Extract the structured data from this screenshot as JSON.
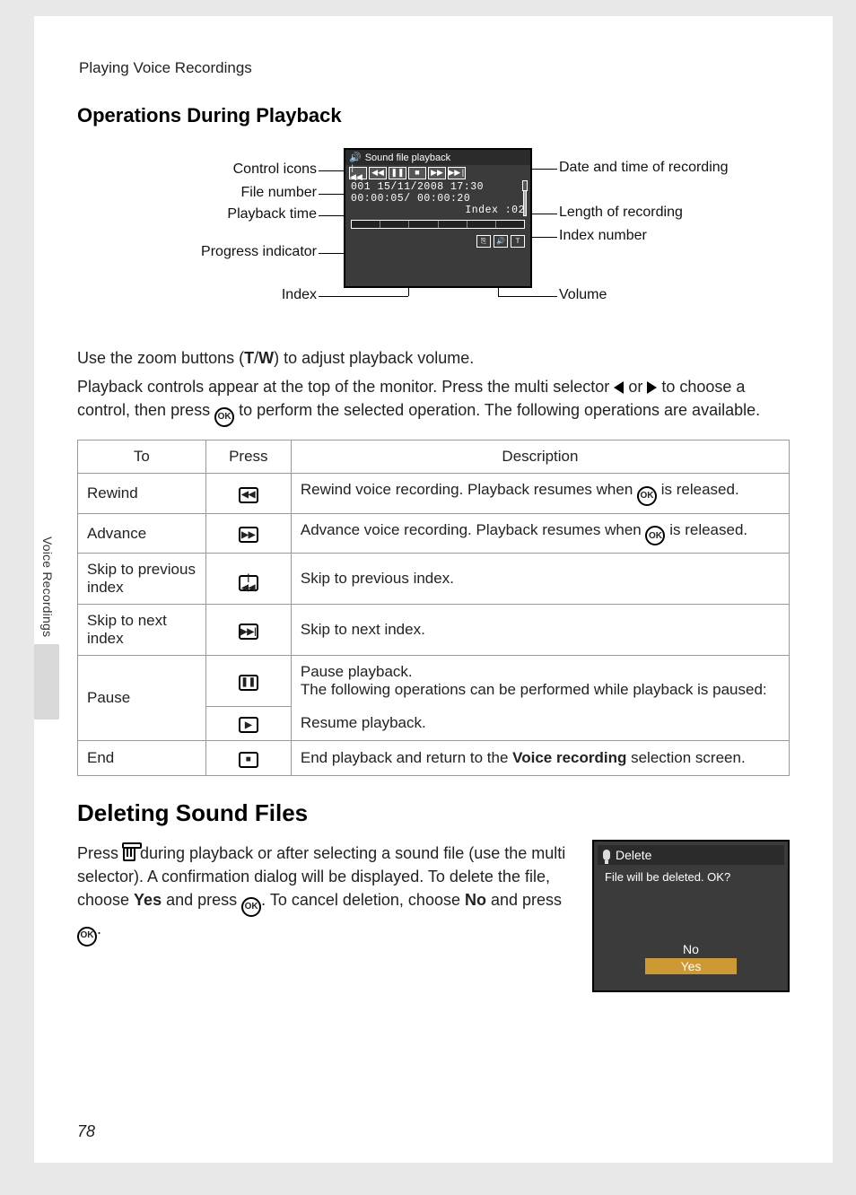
{
  "breadcrumb": "Playing Voice Recordings",
  "sidetab": "Voice Recordings",
  "page_number": "78",
  "heading_operations": "Operations During Playback",
  "callouts": {
    "control_icons": "Control icons",
    "file_number": "File number",
    "playback_time": "Playback time",
    "progress_indicator": "Progress indicator",
    "index": "Index",
    "date_time": "Date and time of recording",
    "length": "Length of recording",
    "index_number": "Index number",
    "volume": "Volume"
  },
  "screen": {
    "title": "Sound file playback",
    "file_line": "001  15/11/2008 17:30",
    "time_line": "00:00:05/ 00:00:20",
    "index_line": "Index :02"
  },
  "para1_a": "Use the zoom buttons (",
  "para1_T": "T",
  "para1_slash": "/",
  "para1_W": "W",
  "para1_b": ") to adjust playback volume.",
  "para2_a": "Playback controls appear at the top of the monitor. Press the multi selector ",
  "para2_b": " or ",
  "para2_c": " to choose a control, then press ",
  "para2_d": " to perform the selected operation. The following operations are available.",
  "table": {
    "headers": {
      "to": "To",
      "press": "Press",
      "desc": "Description"
    },
    "rows": [
      {
        "to": "Rewind",
        "icon": "rewind",
        "desc_a": "Rewind voice recording. Playback resumes when ",
        "desc_b": " is released."
      },
      {
        "to": "Advance",
        "icon": "advance",
        "desc_a": "Advance voice recording. Playback resumes when ",
        "desc_b": " is released."
      },
      {
        "to": "Skip to previous index",
        "icon": "skip-prev",
        "desc": "Skip to previous index."
      },
      {
        "to": "Skip to next index",
        "icon": "skip-next",
        "desc": "Skip to next index."
      },
      {
        "to": "Pause",
        "icon": "pause",
        "icon2": "play",
        "desc_a": "Pause playback.",
        "desc_b": "The following operations can be performed while playback is paused:",
        "desc_c": "Resume playback."
      },
      {
        "to": "End",
        "icon": "stop",
        "desc_a": "End playback and return to the ",
        "desc_bold": "Voice recording",
        "desc_b": " selection screen."
      }
    ]
  },
  "heading_deleting": "Deleting Sound Files",
  "delete_para_a": "Press ",
  "delete_para_b": " during playback or after selecting a sound file (use the multi selector). A confirmation dialog will be displayed. To delete the file, choose ",
  "delete_para_yes": "Yes",
  "delete_para_c": " and press ",
  "delete_para_d": ". To cancel deletion, choose ",
  "delete_para_no": "No",
  "delete_para_e": " and press ",
  "delete_para_f": ".",
  "delete_screen": {
    "title": "Delete",
    "message": "File will be deleted. OK?",
    "no": "No",
    "yes": "Yes"
  }
}
